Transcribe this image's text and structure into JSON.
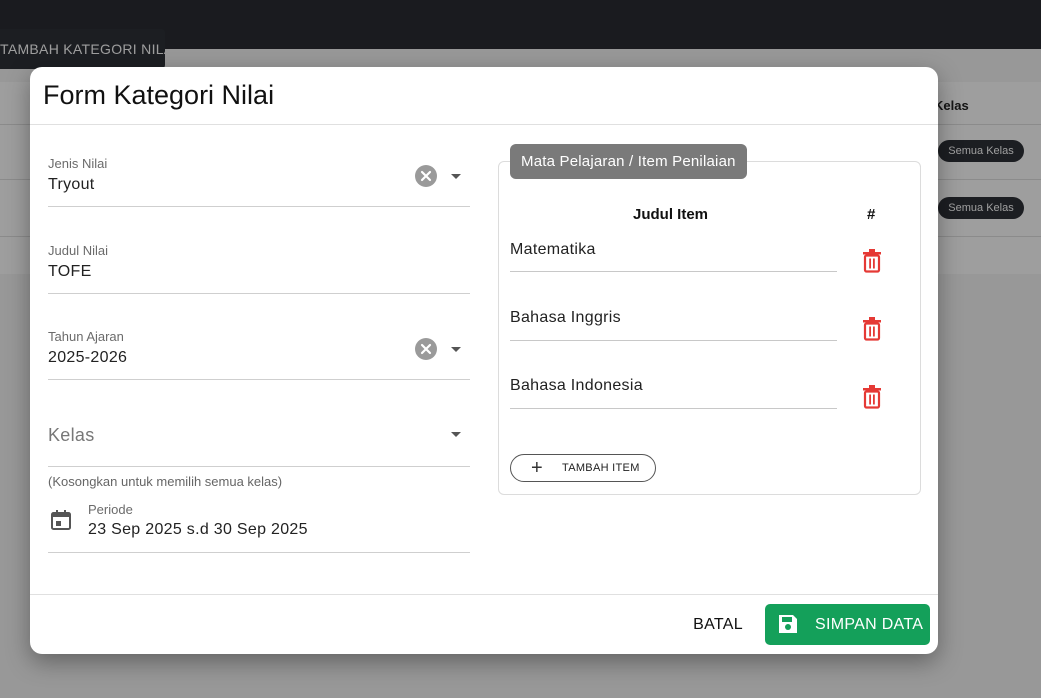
{
  "background": {
    "add_button_label": "TAMBAH KATEGORI NILAI",
    "table_header_label": "Kelas",
    "row_chips": [
      "Semua Kelas",
      "Semua Kelas"
    ]
  },
  "dialog": {
    "title": "Form Kategori Nilai",
    "fields": {
      "jenis_nilai": {
        "label": "Jenis Nilai",
        "value": "Tryout"
      },
      "judul_nilai": {
        "label": "Judul Nilai",
        "value": "TOFE"
      },
      "tahun_ajaran": {
        "label": "Tahun Ajaran",
        "value": "2025-2026"
      },
      "kelas": {
        "placeholder": "Kelas",
        "hint": "(Kosongkan untuk memilih semua kelas)"
      },
      "periode": {
        "label": "Periode",
        "value": "23 Sep 2025 s.d 30 Sep 2025"
      }
    },
    "items_panel": {
      "legend": "Mata Pelajaran / Item Penilaian",
      "col_title": "Judul Item",
      "col_action": "#",
      "items": [
        "Matematika",
        "Bahasa Inggris",
        "Bahasa Indonesia"
      ],
      "add_item_label": "TAMBAH ITEM"
    },
    "actions": {
      "cancel_label": "BATAL",
      "save_label": "SIMPAN DATA"
    }
  },
  "icons": {
    "clear": "clear-circle-icon",
    "dropdown": "chevron-down-icon",
    "calendar": "calendar-icon",
    "delete": "trash-icon",
    "add": "plus-icon",
    "save": "floppy-disk-icon"
  },
  "colors": {
    "primary_save": "#14a05a",
    "delete_red": "#e53935",
    "dark_bar": "#2b2d33"
  }
}
